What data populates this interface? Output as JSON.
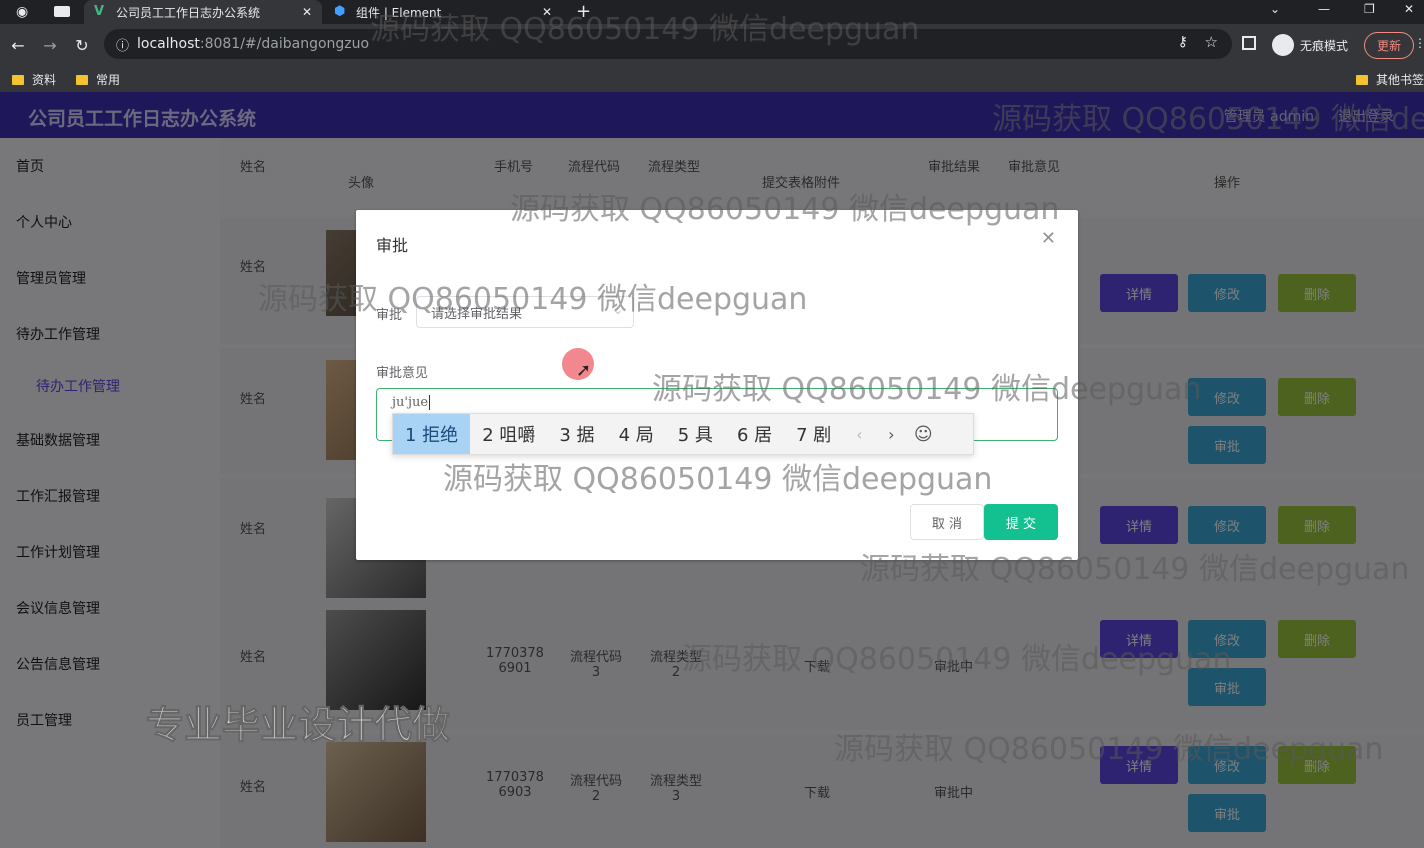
{
  "browser": {
    "tabs": [
      {
        "label": "公司员工工作日志办公系统"
      },
      {
        "label": "组件 | Element"
      }
    ],
    "url_host": "localhost",
    "url_rest": ":8081/#/daibangongzuo",
    "incognito_label": "无痕模式",
    "update_label": "更新",
    "bookmarks": [
      "资料",
      "常用"
    ],
    "other_bookmarks": "其他书签"
  },
  "app": {
    "title": "公司员工工作日志办公系统",
    "header_user": "管理员 admin",
    "header_exit": "退出登录"
  },
  "sidebar": {
    "items": [
      "首页",
      "个人中心",
      "管理员管理",
      "待办工作管理",
      "待办工作管理",
      "基础数据管理",
      "工作汇报管理",
      "工作计划管理",
      "会议信息管理",
      "公告信息管理",
      "员工管理"
    ]
  },
  "table": {
    "headers": [
      "姓名",
      "头像",
      "手机号",
      "流程代码",
      "流程类型",
      "提交表格附件",
      "审批结果",
      "审批意见",
      "操作"
    ],
    "rows": [
      {
        "name": "姓名",
        "phone": "",
        "code": "",
        "type": "",
        "attach": "",
        "result": ""
      },
      {
        "name": "姓名",
        "phone": "",
        "code": "",
        "type": "",
        "attach": "",
        "result": ""
      },
      {
        "name": "姓名",
        "phone": "",
        "code": "",
        "type": "",
        "attach": "",
        "result": ""
      },
      {
        "name": "姓名",
        "phone": "17703786901",
        "code": "流程代码3",
        "type": "流程类型2",
        "attach": "下载",
        "result": "审批中"
      },
      {
        "name": "姓名",
        "phone": "17703786903",
        "code": "流程代码2",
        "type": "流程类型3",
        "attach": "下载",
        "result": "审批中"
      }
    ],
    "btn_detail": "详情",
    "btn_edit": "修改",
    "btn_delete": "删除",
    "btn_review": "审批"
  },
  "dialog": {
    "title": "审批",
    "label_review": "审批",
    "select_placeholder": "请选择审批结果",
    "label_opinion": "审批意见",
    "textarea_value": "ju'jue",
    "cancel": "取 消",
    "submit": "提 交"
  },
  "ime": {
    "candidates": [
      "1 拒绝",
      "2 咀嚼",
      "3 据",
      "4 局",
      "5 具",
      "6 居",
      "7 剧"
    ]
  },
  "watermark": "源码获取 QQ86050149 微信deepguan",
  "promo": "专业毕业设计代做"
}
